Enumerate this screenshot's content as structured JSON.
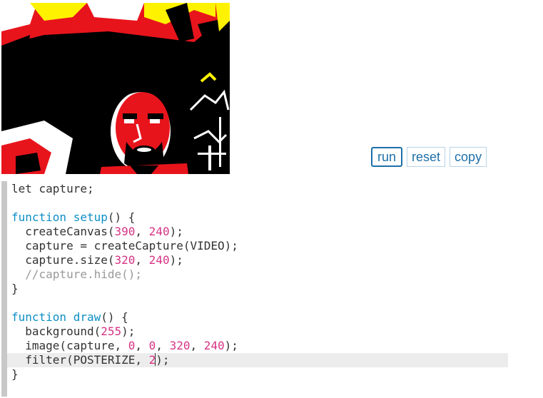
{
  "buttons": {
    "run": "run",
    "reset": "reset",
    "copy": "copy"
  },
  "code": {
    "lines": [
      [
        {
          "t": "let capture;",
          "c": ""
        }
      ],
      [],
      [
        {
          "t": "function ",
          "c": "kw"
        },
        {
          "t": "setup",
          "c": "kw"
        },
        {
          "t": "() {",
          "c": ""
        }
      ],
      [
        {
          "t": "  createCanvas(",
          "c": ""
        },
        {
          "t": "390",
          "c": "num"
        },
        {
          "t": ", ",
          "c": ""
        },
        {
          "t": "240",
          "c": "num"
        },
        {
          "t": ");",
          "c": ""
        }
      ],
      [
        {
          "t": "  capture = createCapture(VIDEO);",
          "c": ""
        }
      ],
      [
        {
          "t": "  capture.size(",
          "c": ""
        },
        {
          "t": "320",
          "c": "num"
        },
        {
          "t": ", ",
          "c": ""
        },
        {
          "t": "240",
          "c": "num"
        },
        {
          "t": ");",
          "c": ""
        }
      ],
      [
        {
          "t": "  //capture.hide();",
          "c": "cm"
        }
      ],
      [
        {
          "t": "}",
          "c": ""
        }
      ],
      [],
      [
        {
          "t": "function ",
          "c": "kw"
        },
        {
          "t": "draw",
          "c": "kw"
        },
        {
          "t": "() {",
          "c": ""
        }
      ],
      [
        {
          "t": "  background(",
          "c": ""
        },
        {
          "t": "255",
          "c": "num"
        },
        {
          "t": ");",
          "c": ""
        }
      ],
      [
        {
          "t": "  image(capture, ",
          "c": ""
        },
        {
          "t": "0",
          "c": "num"
        },
        {
          "t": ", ",
          "c": ""
        },
        {
          "t": "0",
          "c": "num"
        },
        {
          "t": ", ",
          "c": ""
        },
        {
          "t": "320",
          "c": "num"
        },
        {
          "t": ", ",
          "c": ""
        },
        {
          "t": "240",
          "c": "num"
        },
        {
          "t": ");",
          "c": ""
        }
      ],
      [
        {
          "t": "  filter(POSTERIZE, ",
          "c": ""
        },
        {
          "t": "2",
          "c": "num"
        },
        {
          "t": "|",
          "c": "cursor"
        },
        {
          "t": ");",
          "c": ""
        }
      ],
      [
        {
          "t": "}",
          "c": ""
        }
      ]
    ],
    "active_line": 12
  },
  "colors": {
    "keyword": "#0d8fc4",
    "number": "#d63384",
    "comment": "#999999",
    "button_text": "#1e6fa8"
  },
  "canvas": {
    "description_icon": "webcam-frame-image"
  }
}
